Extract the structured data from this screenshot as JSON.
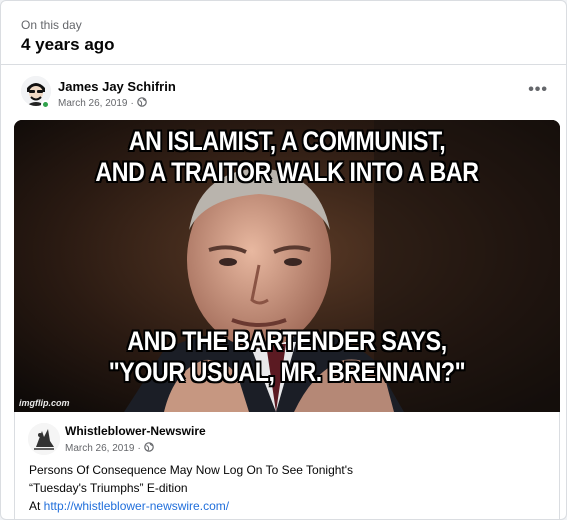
{
  "memory": {
    "label": "On this day",
    "title": "4 years ago"
  },
  "post": {
    "author": "James Jay Schifrin",
    "date": "March 26, 2019",
    "separator": "·",
    "privacy_icon": "globe-icon",
    "more_label": "•••",
    "online_status_color": "#31a24c"
  },
  "meme": {
    "top_line_1": "AN ISLAMIST, A COMMUNIST,",
    "top_line_2": "AND A TRAITOR WALK INTO A BAR",
    "bottom_line_1": "AND THE BARTENDER SAYS,",
    "bottom_line_2": "\"YOUR USUAL, MR. BRENNAN?\"",
    "watermark": "imgflip.com"
  },
  "shared_post": {
    "author": "Whistleblower-Newswire",
    "date": "March 26, 2019",
    "separator": "·",
    "privacy_icon": "globe-icon",
    "text_line_1": "Persons Of Consequence May Now Log On To See Tonight's",
    "text_line_2": "“Tuesday's Triumphs” E-dition",
    "text_line_3_prefix": "At ",
    "link": "http://whistleblower-newswire.com/"
  },
  "colors": {
    "link": "#216fdb",
    "secondary_text": "#65676b",
    "border": "#dadde1"
  }
}
